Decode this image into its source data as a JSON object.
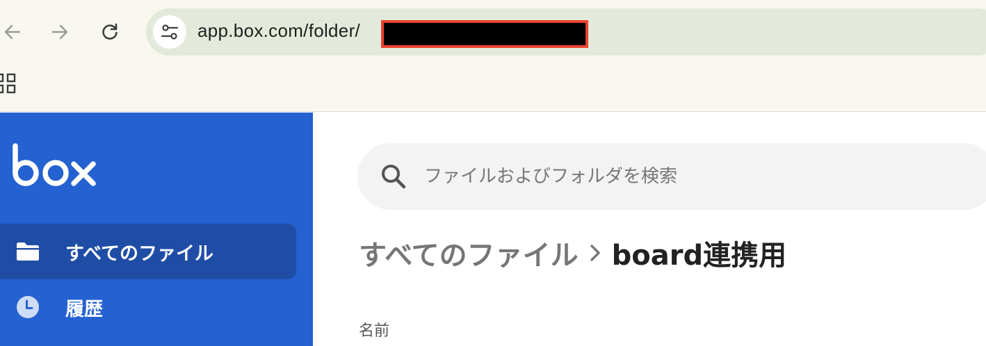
{
  "browser": {
    "url": "app.box.com/folder/"
  },
  "sidebar": {
    "logo": "box",
    "items": [
      {
        "label": "すべてのファイル",
        "icon": "folder-icon",
        "active": true
      },
      {
        "label": "履歴",
        "icon": "clock-icon",
        "active": false
      }
    ]
  },
  "search": {
    "placeholder": "ファイルおよびフォルダを検索"
  },
  "breadcrumb": {
    "parent": "すべてのファイル",
    "current": "board連携用"
  },
  "table": {
    "columns": [
      "名前"
    ]
  },
  "colors": {
    "sidebar": "#2461d1",
    "sidebar_active": "#1f4da6",
    "omnibox": "#e3eadb",
    "chrome": "#f8f8f0",
    "redaction_border": "#e8432d"
  }
}
